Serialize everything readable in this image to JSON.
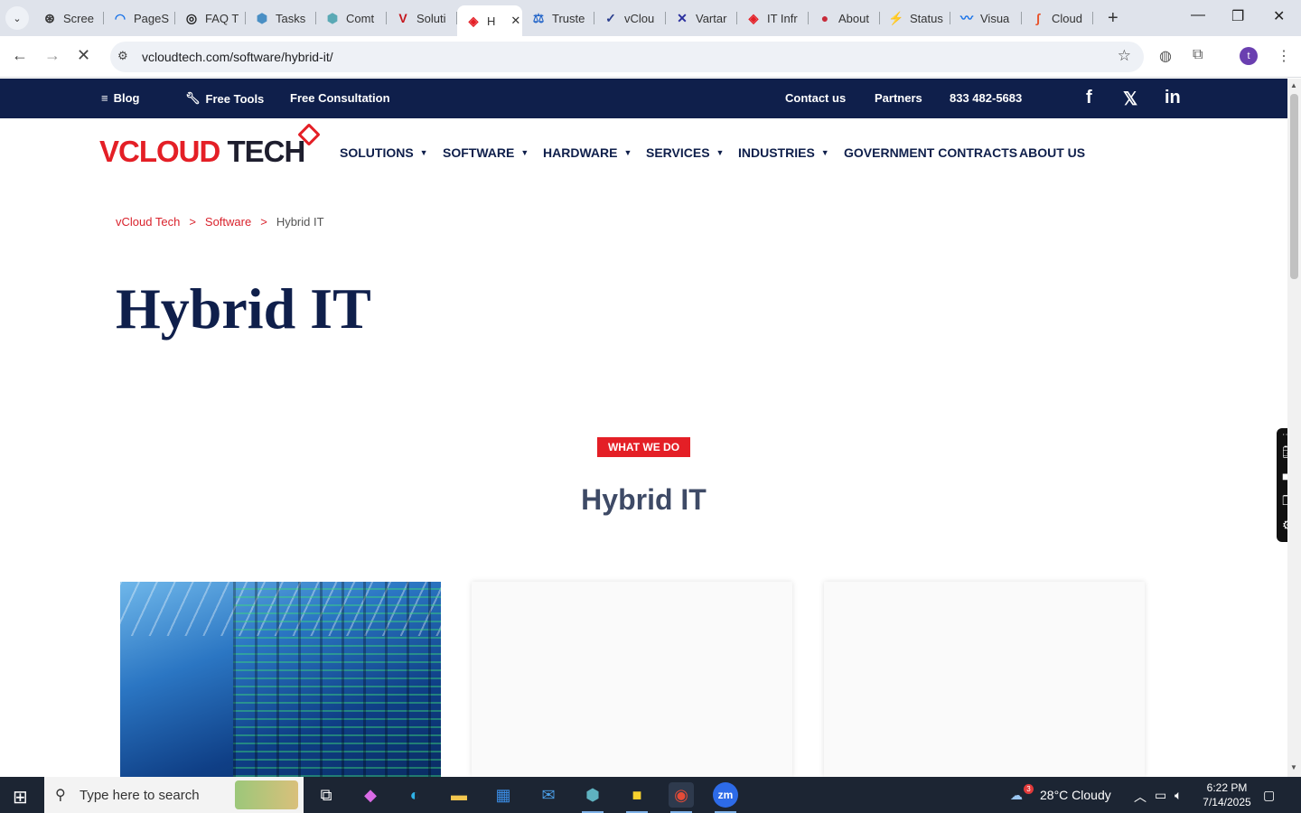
{
  "browser": {
    "tabs": [
      {
        "label": "Scree",
        "icon": "#333",
        "glyph": "⊛"
      },
      {
        "label": "PageS",
        "icon": "#1a73e8",
        "glyph": "◠"
      },
      {
        "label": "FAQ T",
        "icon": "#222",
        "glyph": "◎"
      },
      {
        "label": "Tasks",
        "icon": "#4a8fc4",
        "glyph": "⬢"
      },
      {
        "label": "Comt",
        "icon": "#5aa9b5",
        "glyph": "⬢"
      },
      {
        "label": "Soluti",
        "icon": "#c5161d",
        "glyph": "V"
      },
      {
        "label": "H",
        "icon": "#e41f26",
        "glyph": "◈",
        "active": true
      },
      {
        "label": "Truste",
        "icon": "#2667c9",
        "glyph": "⚖"
      },
      {
        "label": "vClou",
        "icon": "#2b3f8e",
        "glyph": "✓"
      },
      {
        "label": "Vartar",
        "icon": "#2a2f9e",
        "glyph": "✕"
      },
      {
        "label": "IT Infr",
        "icon": "#e41f26",
        "glyph": "◈"
      },
      {
        "label": "About",
        "icon": "#c72b3a",
        "glyph": "●"
      },
      {
        "label": "Status",
        "icon": "#e0337a",
        "glyph": "⚡"
      },
      {
        "label": "Visua",
        "icon": "#1a73e8",
        "glyph": "〰"
      },
      {
        "label": "Cloud",
        "icon": "#e8532b",
        "glyph": "∫"
      }
    ],
    "url": "vcloudtech.com/software/hybrid-it/",
    "profile_initial": "t"
  },
  "topstrip": {
    "blog": "Blog",
    "free_tools": "Free Tools",
    "free_consultation": "Free Consultation",
    "contact": "Contact us",
    "partners": "Partners",
    "phone": "833 482-5683"
  },
  "logo": {
    "v": "V",
    "cloud": "CLOUD ",
    "tech": "TECH"
  },
  "nav": [
    {
      "label": "SOLUTIONS",
      "caret": true
    },
    {
      "label": "SOFTWARE",
      "caret": true
    },
    {
      "label": "HARDWARE",
      "caret": true
    },
    {
      "label": "SERVICES",
      "caret": true
    },
    {
      "label": "INDUSTRIES",
      "caret": true
    },
    {
      "label": "GOVERNMENT CONTRACTS",
      "caret": false
    },
    {
      "label": "ABOUT US",
      "caret": false
    }
  ],
  "breadcrumb": {
    "home": "vCloud Tech",
    "section": "Software",
    "current": "Hybrid IT",
    "sep": ">"
  },
  "hero": {
    "title": "Hybrid IT"
  },
  "section": {
    "badge": "WHAT WE DO",
    "title": "Hybrid IT"
  },
  "taskbar": {
    "search_placeholder": "Type here to search",
    "weather": "28°C  Cloudy",
    "weather_badge": "3",
    "time": "6:22 PM",
    "date": "7/14/2025"
  }
}
